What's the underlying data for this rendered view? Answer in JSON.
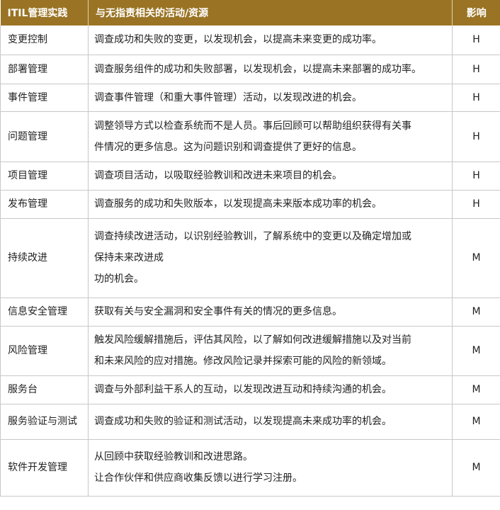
{
  "header": {
    "practice": "ITIL管理实践",
    "activities": "与无指责相关的活动/资源",
    "impact": "影响"
  },
  "rows": [
    {
      "practice": "变更控制",
      "desc": [
        "调查成功和失败的变更，以发现机会，以提高未来变更的成功率。"
      ],
      "impact": "H"
    },
    {
      "practice": "部署管理",
      "desc": [
        "调查服务组件的成功和失败部署，以发现机会，以提高未来部署的成功率。"
      ],
      "impact": "H"
    },
    {
      "practice": "事件管理",
      "desc": [
        "调查事件管理（和重大事件管理）活动，以发现改进的机会。"
      ],
      "impact": "H"
    },
    {
      "practice": "问题管理",
      "desc": [
        "调整领导方式以检查系统而不是人员。事后回顾可以帮助组织获得有关事",
        "件情况的更多信息。这为问题识别和调查提供了更好的信息。"
      ],
      "impact": "H"
    },
    {
      "practice": "项目管理",
      "desc": [
        "调查项目活动，以吸取经验教训和改进未来项目的机会。"
      ],
      "impact": "H"
    },
    {
      "practice": "发布管理",
      "desc": [
        "调查服务的成功和失败版本，以发现提高未来版本成功率的机会。"
      ],
      "impact": "H"
    },
    {
      "practice": "持续改进",
      "desc": [
        "调查持续改进活动，以识别经验教训，了解系统中的变更以及确定增加或",
        "保持未来改进成",
        "功的机会。"
      ],
      "impact": "M"
    },
    {
      "practice": "信息安全管理",
      "desc": [
        "获取有关与安全漏洞和安全事件有关的情况的更多信息。"
      ],
      "impact": "M"
    },
    {
      "practice": "风险管理",
      "desc": [
        "触发风险缓解措施后，评估其风险，以了解如何改进缓解措施以及对当前",
        "和未来风险的应对措施。修改风险记录并探索可能的风险的新领域。"
      ],
      "impact": "M"
    },
    {
      "practice": "服务台",
      "desc": [
        "调查与外部利益干系人的互动，以发现改进互动和持续沟通的机会。"
      ],
      "impact": "M"
    },
    {
      "practice": "服务验证与测试",
      "desc": [
        "调查成功和失败的验证和测试活动，以发现提高未来成功率的机会。"
      ],
      "impact": "M"
    },
    {
      "practice": "软件开发管理",
      "desc": [
        "从回顾中获取经验教训和改进思路。",
        "让合作伙伴和供应商收集反馈以进行学习注册。"
      ],
      "impact": "M"
    }
  ]
}
